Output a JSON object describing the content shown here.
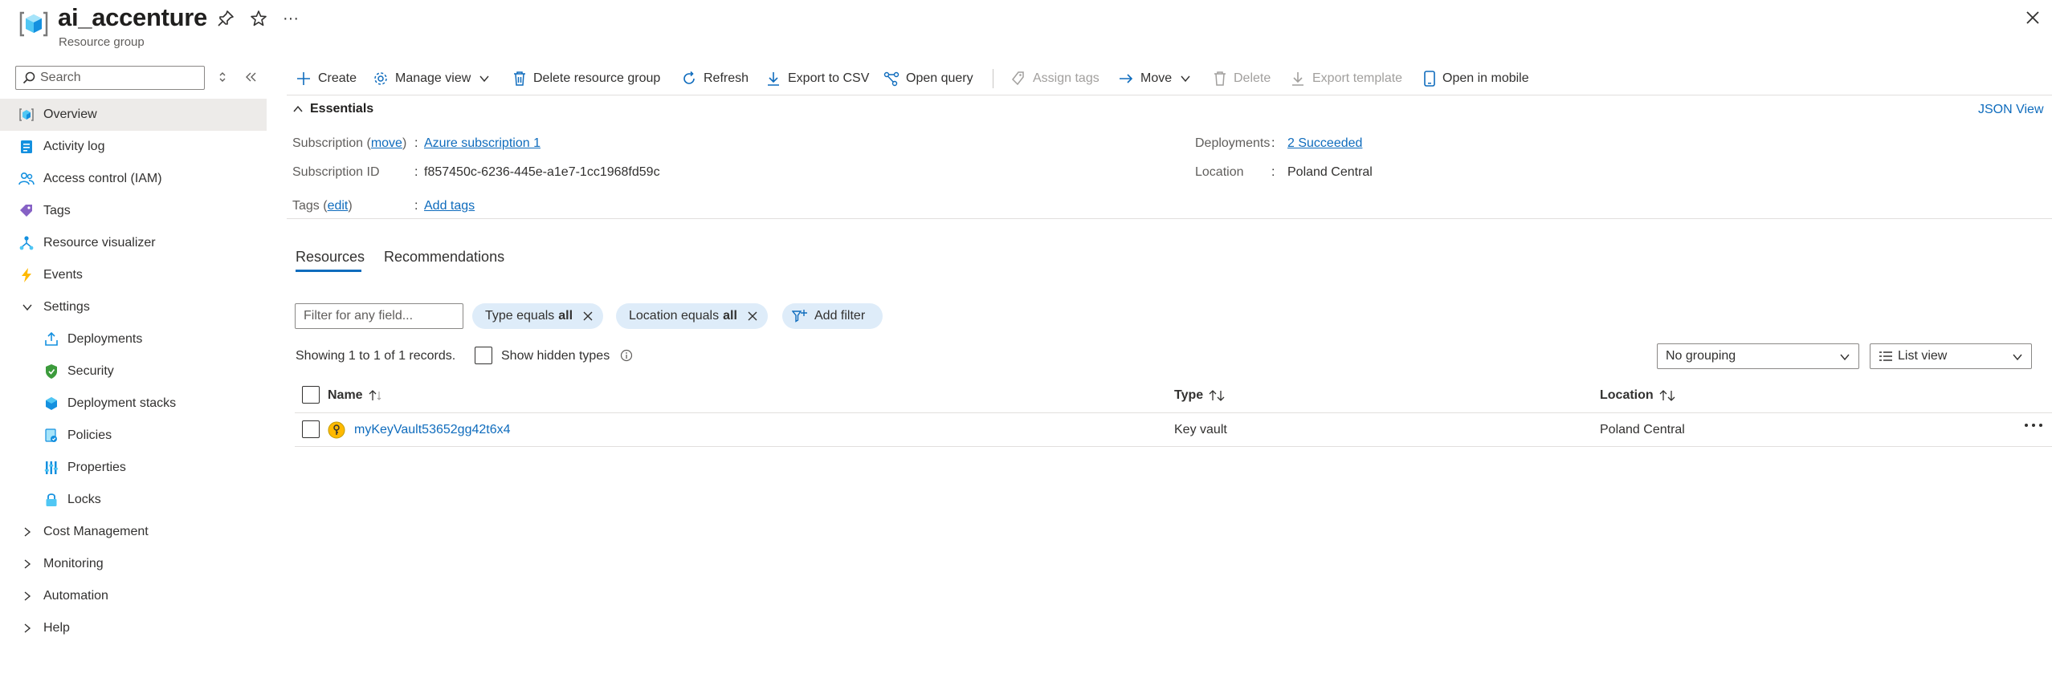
{
  "header": {
    "title": "ai_accenture",
    "subtitle": "Resource group",
    "more": "···"
  },
  "sidebar": {
    "search_placeholder": "Search",
    "items": [
      {
        "label": "Overview"
      },
      {
        "label": "Activity log"
      },
      {
        "label": "Access control (IAM)"
      },
      {
        "label": "Tags"
      },
      {
        "label": "Resource visualizer"
      },
      {
        "label": "Events"
      },
      {
        "label": "Settings"
      },
      {
        "label": "Deployments"
      },
      {
        "label": "Security"
      },
      {
        "label": "Deployment stacks"
      },
      {
        "label": "Policies"
      },
      {
        "label": "Properties"
      },
      {
        "label": "Locks"
      },
      {
        "label": "Cost Management"
      },
      {
        "label": "Monitoring"
      },
      {
        "label": "Automation"
      },
      {
        "label": "Help"
      }
    ]
  },
  "toolbar": {
    "create": "Create",
    "manage_view": "Manage view",
    "delete_rg": "Delete resource group",
    "refresh": "Refresh",
    "export_csv": "Export to CSV",
    "open_query": "Open query",
    "assign_tags": "Assign tags",
    "move": "Move",
    "delete": "Delete",
    "export_template": "Export template",
    "open_mobile": "Open in mobile"
  },
  "essentials": {
    "heading": "Essentials",
    "json_view": "JSON View",
    "subscription_label": "Subscription",
    "subscription_move": "move",
    "subscription_value": "Azure subscription 1",
    "subscription_id_label": "Subscription ID",
    "subscription_id_value": "f857450c-6236-445e-a1e7-1cc1968fd59c",
    "tags_label": "Tags",
    "tags_edit": "edit",
    "tags_value": "Add tags",
    "deployments_label": "Deployments",
    "deployments_value": "2 Succeeded",
    "location_label": "Location",
    "location_value": "Poland Central",
    "colon": ":"
  },
  "tabs": {
    "resources": "Resources",
    "recommendations": "Recommendations"
  },
  "filters": {
    "placeholder": "Filter for any field...",
    "type_pill_prefix": "Type equals",
    "type_pill_value": "all",
    "location_pill_prefix": "Location equals",
    "location_pill_value": "all",
    "add_filter": "Add filter"
  },
  "records": {
    "summary": "Showing 1 to 1 of 1 records.",
    "show_hidden": "Show hidden types",
    "grouping": "No grouping",
    "view": "List view"
  },
  "table": {
    "columns": {
      "name": "Name",
      "type": "Type",
      "location": "Location"
    },
    "rows": [
      {
        "name": "myKeyVault53652gg42t6x4",
        "type": "Key vault",
        "location": "Poland Central"
      }
    ]
  },
  "colors": {
    "accent": "#0f6cbd",
    "pill_bg": "#deecf9",
    "active_nav_bg": "#edebe9"
  }
}
